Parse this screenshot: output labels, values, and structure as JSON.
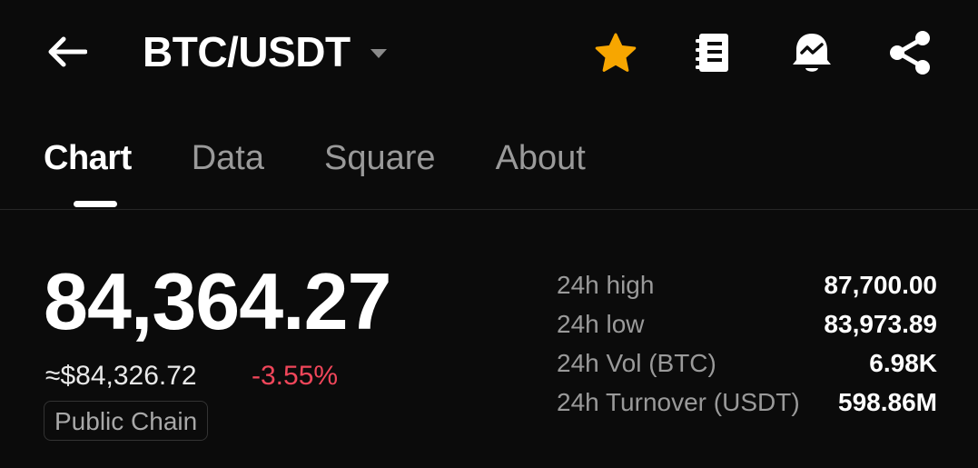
{
  "header": {
    "pair": "BTC/USDT",
    "icons": {
      "back": "arrow-left-icon",
      "caret": "caret-down-icon",
      "favorite": "star-icon",
      "notes": "notebook-icon",
      "alert": "bell-alert-icon",
      "share": "share-icon"
    },
    "favorite_color": "#f7a600"
  },
  "tabs": [
    {
      "label": "Chart",
      "active": true
    },
    {
      "label": "Data",
      "active": false
    },
    {
      "label": "Square",
      "active": false
    },
    {
      "label": "About",
      "active": false
    }
  ],
  "ticker": {
    "last_price": "84,364.27",
    "usd_price": "≈$84,326.72",
    "change_pct": "-3.55%",
    "change_color": "#f0465a",
    "tag": "Public Chain"
  },
  "stats": [
    {
      "label": "24h high",
      "value": "87,700.00"
    },
    {
      "label": "24h low",
      "value": "83,973.89"
    },
    {
      "label": "24h Vol (BTC)",
      "value": "6.98K"
    },
    {
      "label": "24h Turnover (USDT)",
      "value": "598.86M"
    }
  ]
}
